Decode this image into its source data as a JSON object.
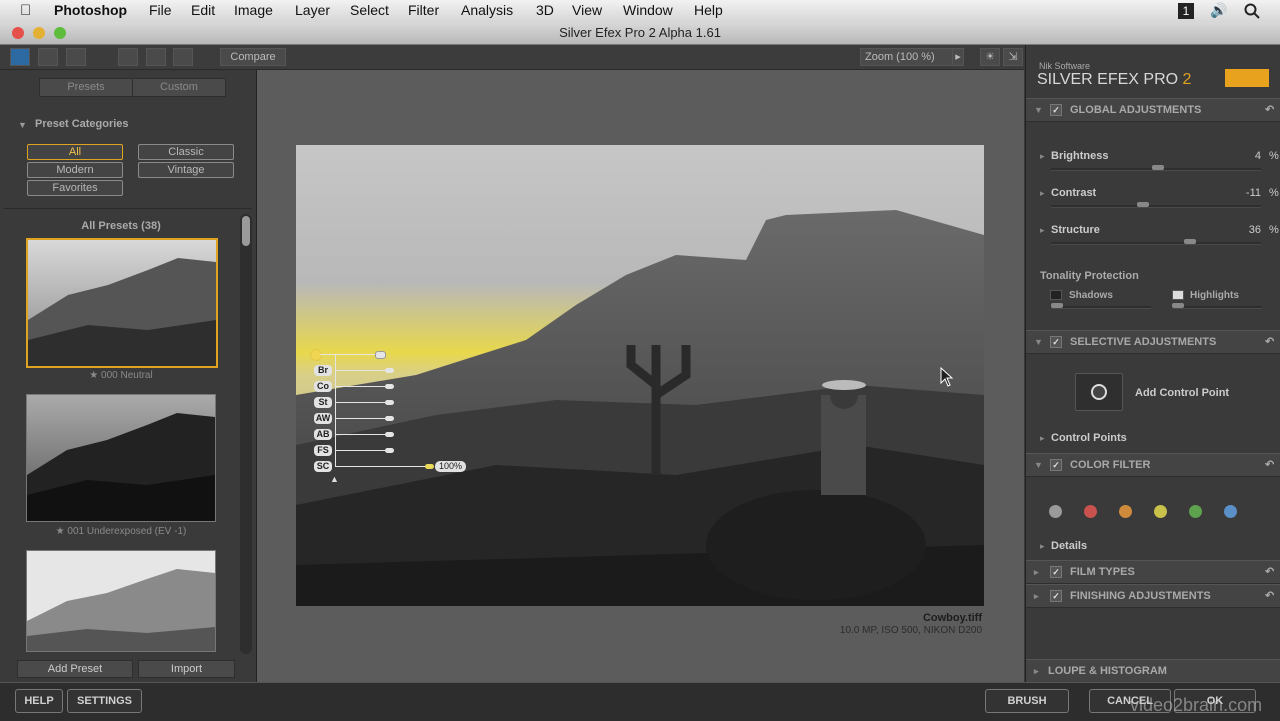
{
  "menubar": {
    "app": "Photoshop",
    "items": [
      "File",
      "Edit",
      "Image",
      "Layer",
      "Select",
      "Filter",
      "Analysis",
      "3D",
      "View",
      "Window",
      "Help"
    ],
    "right_badge": "1"
  },
  "window": {
    "title": "Silver Efex Pro 2 Alpha 1.61"
  },
  "toolbar": {
    "compare": "Compare",
    "zoom": "Zoom (100 %)"
  },
  "left": {
    "tabs": [
      "Presets",
      "Custom"
    ],
    "preset_categories": "Preset Categories",
    "categories": [
      "All",
      "Classic",
      "Modern",
      "Vintage",
      "Favorites"
    ],
    "all_presets": "All Presets (38)",
    "thumbs": [
      {
        "caption": "000 Neutral"
      },
      {
        "caption": "001 Underexposed (EV -1)"
      }
    ],
    "add_preset": "Add Preset",
    "import": "Import"
  },
  "center": {
    "control_point_labels": [
      "Br",
      "Co",
      "St",
      "AW",
      "AB",
      "FS",
      "SC"
    ],
    "control_point_value": "100%",
    "filename": "Cowboy.tiff",
    "fileinfo": "10.0 MP, ISO 500, NIKON D200"
  },
  "right": {
    "brand_small": "Nik Software",
    "brand_big": "SILVER EFEX PRO",
    "brand_num": "2",
    "global": "GLOBAL ADJUSTMENTS",
    "sliders": [
      {
        "label": "Brightness",
        "value": "4",
        "unit": "%"
      },
      {
        "label": "Contrast",
        "value": "-11",
        "unit": "%"
      },
      {
        "label": "Structure",
        "value": "36",
        "unit": "%"
      }
    ],
    "tonality": "Tonality Protection",
    "shadows": "Shadows",
    "highlights": "Highlights",
    "selective": "SELECTIVE ADJUSTMENTS",
    "add_control_point": "Add Control Point",
    "control_points": "Control Points",
    "color_filter": "COLOR FILTER",
    "filter_colors": [
      "#9a9a9a",
      "#c9524e",
      "#d08a3c",
      "#c8c24a",
      "#5ea24e",
      "#5b8fc7"
    ],
    "details": "Details",
    "film_types": "FILM TYPES",
    "finishing": "FINISHING ADJUSTMENTS",
    "loupe": "LOUPE & HISTOGRAM"
  },
  "bottom": {
    "help": "HELP",
    "settings": "SETTINGS",
    "brush": "BRUSH",
    "cancel": "CANCEL",
    "ok": "OK",
    "watermark": "video2brain.com"
  }
}
